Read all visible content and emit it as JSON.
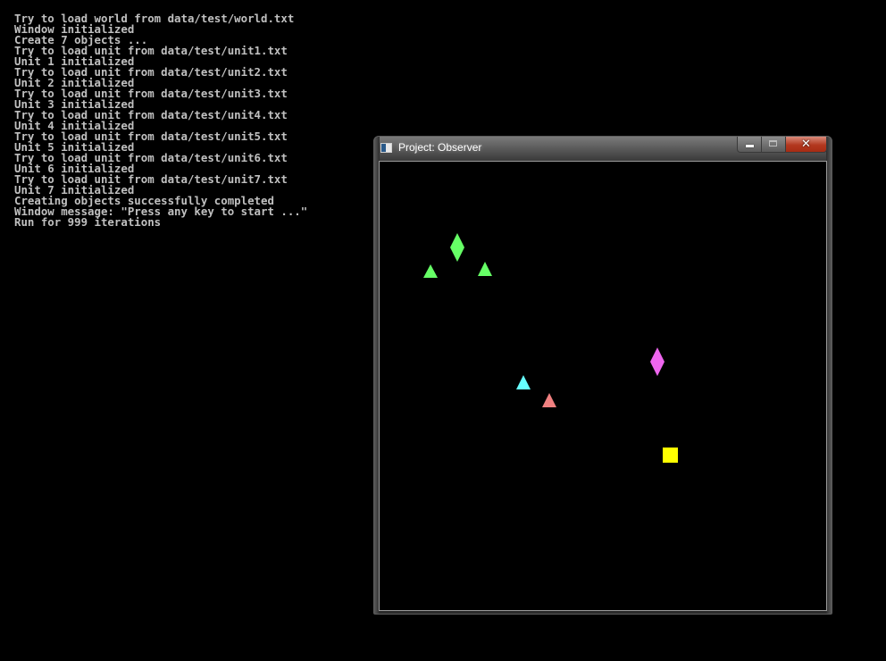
{
  "console": {
    "lines": [
      "Try to load world from data/test/world.txt",
      "Window initialized",
      "Create 7 objects ...",
      "Try to load unit from data/test/unit1.txt",
      "Unit 1 initialized",
      "Try to load unit from data/test/unit2.txt",
      "Unit 2 initialized",
      "Try to load unit from data/test/unit3.txt",
      "Unit 3 initialized",
      "Try to load unit from data/test/unit4.txt",
      "Unit 4 initialized",
      "Try to load unit from data/test/unit5.txt",
      "Unit 5 initialized",
      "Try to load unit from data/test/unit6.txt",
      "Unit 6 initialized",
      "Try to load unit from data/test/unit7.txt",
      "Unit 7 initialized",
      "Creating objects successfully completed",
      "Window message: \"Press any key to start ...\"",
      "Run for 999 iterations"
    ],
    "text_color": "#c0c0c0",
    "background": "#000000"
  },
  "window": {
    "title": "Project: Observer",
    "app_icon": "console-app-icon",
    "buttons": {
      "minimize_icon": "minimize-icon",
      "maximize_icon": "maximize-icon",
      "close_icon": "close-icon",
      "close_glyph": "✕"
    },
    "close_color": "#c0391b",
    "canvas_background": "#000000"
  },
  "world": {
    "units": [
      {
        "id": "unit-green-diamond",
        "shape": "diamond",
        "color": "#66ff66"
      },
      {
        "id": "unit-green-triangle-left",
        "shape": "triangle",
        "color": "#66ff66"
      },
      {
        "id": "unit-green-triangle-right",
        "shape": "triangle",
        "color": "#66ff66"
      },
      {
        "id": "unit-magenta-diamond",
        "shape": "diamond",
        "color": "#ee66ee"
      },
      {
        "id": "unit-cyan-triangle",
        "shape": "triangle",
        "color": "#66ffff"
      },
      {
        "id": "unit-red-triangle",
        "shape": "triangle",
        "color": "#f08080"
      },
      {
        "id": "unit-yellow-square",
        "shape": "square",
        "color": "#ffff00"
      }
    ]
  }
}
